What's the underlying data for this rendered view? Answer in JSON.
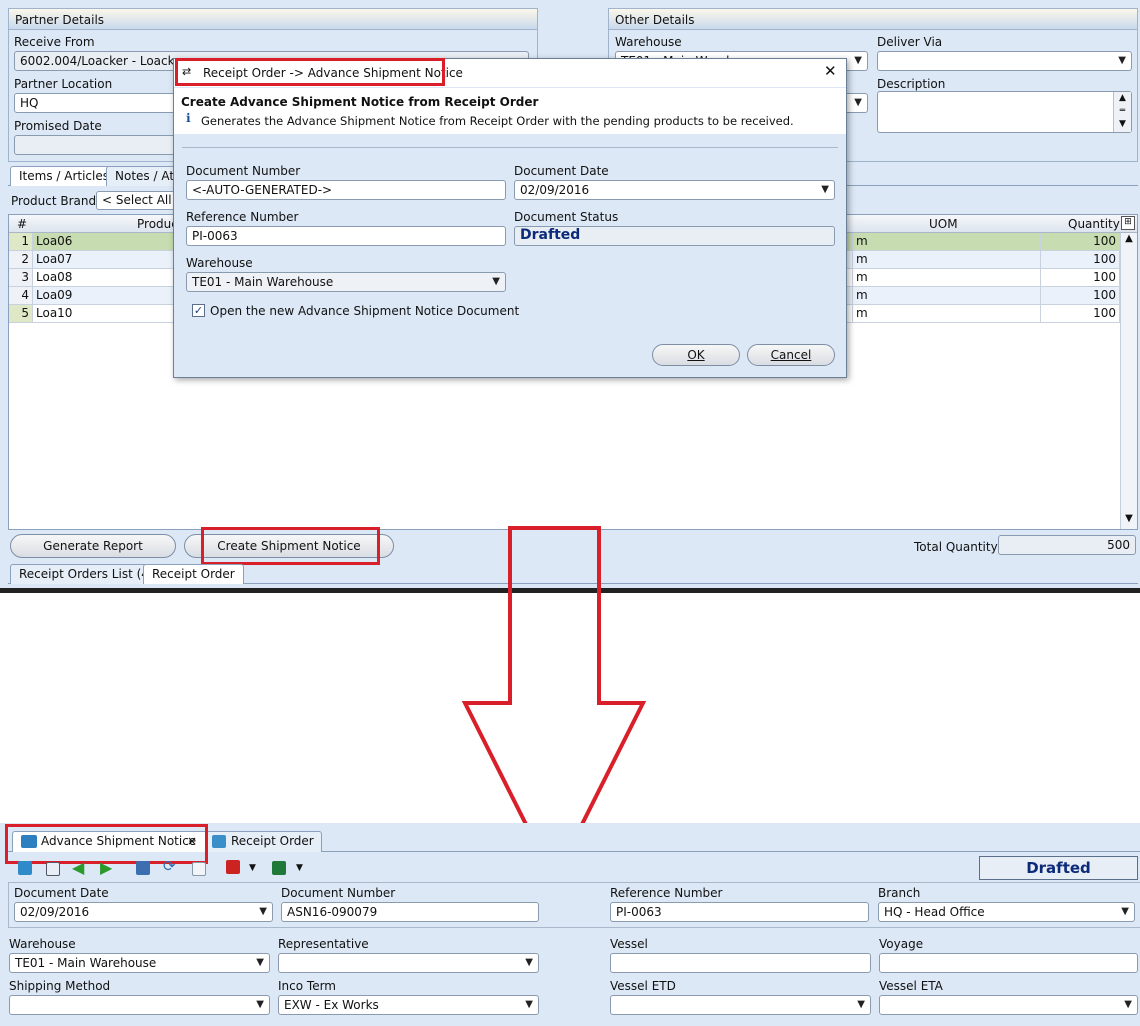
{
  "top": {
    "partner_details": {
      "title": "Partner Details",
      "receive_from_label": "Receive From",
      "receive_from_value": "6002.004/Loacker - Loacker",
      "partner_location_label": "Partner Location",
      "partner_location_value": "HQ",
      "promised_date_label": "Promised Date",
      "promised_date_value": ""
    },
    "other_details": {
      "title": "Other Details",
      "warehouse_label": "Warehouse",
      "warehouse_value": "TE01 - Main Warehouse",
      "deliver_via_label": "Deliver Via",
      "deliver_via_value": "",
      "description_label": "Description",
      "description_value": ""
    },
    "tabs": [
      "Items / Articles",
      "Notes / Attachments"
    ],
    "product_brand_label": "Product Brand:",
    "product_brand_value": "< Select All >",
    "table": {
      "headers": {
        "num": "#",
        "product": "Product",
        "uom": "UOM",
        "quantity": "Quantity"
      },
      "rows": [
        {
          "num": "1",
          "product": "Loa06",
          "uom": "m",
          "qty": "100"
        },
        {
          "num": "2",
          "product": "Loa07",
          "uom": "m",
          "qty": "100"
        },
        {
          "num": "3",
          "product": "Loa08",
          "uom": "m",
          "qty": "100"
        },
        {
          "num": "4",
          "product": "Loa09",
          "uom": "m",
          "qty": "100"
        },
        {
          "num": "5",
          "product": "Loa10",
          "uom": "m",
          "qty": "100"
        }
      ]
    },
    "buttons": {
      "generate_report": "Generate Report",
      "create_shipment_notice": "Create Shipment Notice"
    },
    "total_quantity_label": "Total Quantity:",
    "total_quantity_value": "500",
    "bottom_tabs": [
      "Receipt Orders List (4)",
      "Receipt Order"
    ]
  },
  "dialog": {
    "title": "Receipt Order -> Advance Shipment Notice",
    "heading": "Create Advance Shipment Notice from Receipt Order",
    "info": "Generates the Advance Shipment Notice from Receipt Order with the pending products to be received.",
    "document_number_label": "Document Number",
    "document_number_value": "<-AUTO-GENERATED->",
    "document_date_label": "Document Date",
    "document_date_value": "02/09/2016",
    "reference_number_label": "Reference Number",
    "reference_number_value": "PI-0063",
    "document_status_label": "Document Status",
    "document_status_value": "Drafted",
    "warehouse_label": "Warehouse",
    "warehouse_value": "TE01 - Main Warehouse",
    "open_new_label": "Open the new Advance Shipment Notice Document",
    "ok_label": "OK",
    "cancel_label": "Cancel",
    "close_glyph": "✕"
  },
  "bottom": {
    "tabs": [
      "Advance Shipment Notice",
      "Receipt Order"
    ],
    "tab_close_glyph": "×",
    "status": "Drafted",
    "document_date_label": "Document Date",
    "document_date_value": "02/09/2016",
    "document_number_label": "Document Number",
    "document_number_value": "ASN16-090079",
    "reference_number_label": "Reference Number",
    "reference_number_value": "PI-0063",
    "branch_label": "Branch",
    "branch_value": "HQ - Head Office",
    "warehouse_label": "Warehouse",
    "warehouse_value": "TE01 - Main Warehouse",
    "representative_label": "Representative",
    "representative_value": "",
    "vessel_label": "Vessel",
    "vessel_value": "",
    "voyage_label": "Voyage",
    "voyage_value": "",
    "shipping_method_label": "Shipping Method",
    "shipping_method_value": "",
    "inco_term_label": "Inco Term",
    "inco_term_value": "EXW - Ex Works",
    "vessel_etd_label": "Vessel ETD",
    "vessel_etd_value": "",
    "vessel_eta_label": "Vessel ETA",
    "vessel_eta_value": ""
  },
  "colors": {
    "window_bg": "#dce8f6",
    "highlight_red": "#d9202a",
    "status_blue": "#0b2a7a",
    "row_selected": "#c7dcb0"
  }
}
